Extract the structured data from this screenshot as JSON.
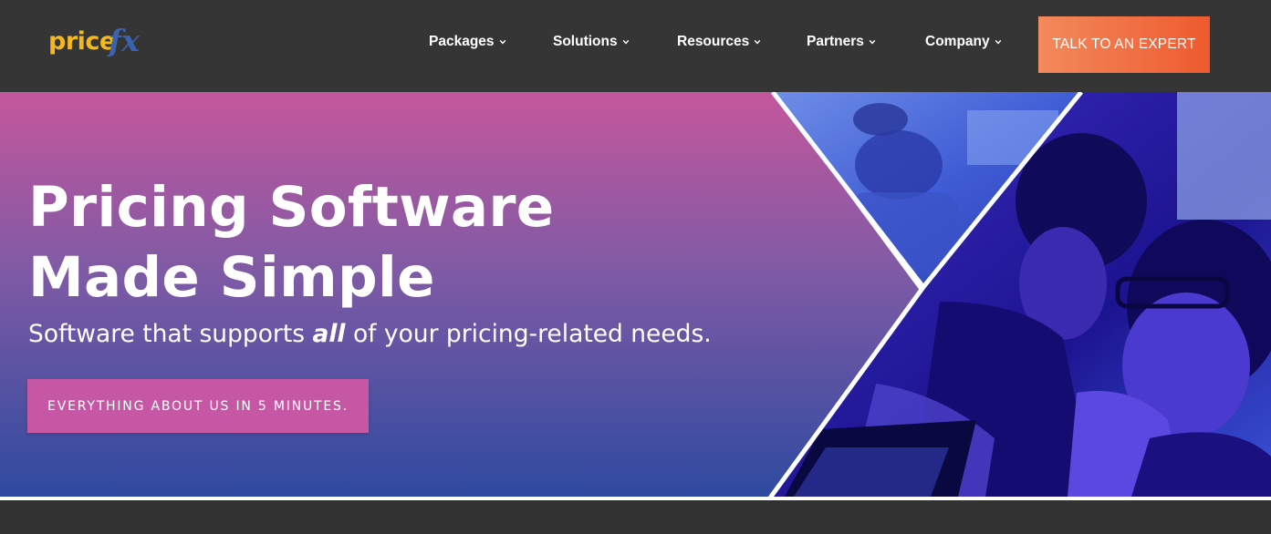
{
  "logo": {
    "part1": "price",
    "part2": "fx"
  },
  "nav": [
    {
      "label": "Packages"
    },
    {
      "label": "Solutions"
    },
    {
      "label": "Resources"
    },
    {
      "label": "Partners"
    },
    {
      "label": "Company"
    }
  ],
  "cta": {
    "label": "TALK TO AN EXPERT"
  },
  "hero": {
    "title": "Pricing Software Made Simple",
    "subtitle_before": "Software that supports ",
    "subtitle_emphasis": "all",
    "subtitle_after": " of your pricing-related needs.",
    "button_label": "EVERYTHING ABOUT US IN 5 MINUTES."
  },
  "colors": {
    "header_bg": "#353535",
    "logo_price": "#f4b81e",
    "logo_fx": "#3a62ae",
    "cta_start": "#f28a5c",
    "cta_end": "#ee5a2f",
    "hero_gradient_top": "#c5579c",
    "hero_gradient_bottom": "#2e4aa0",
    "hero_button": "#c557a4"
  },
  "icons": {
    "nav_dropdown": "chevron-down-icon"
  }
}
